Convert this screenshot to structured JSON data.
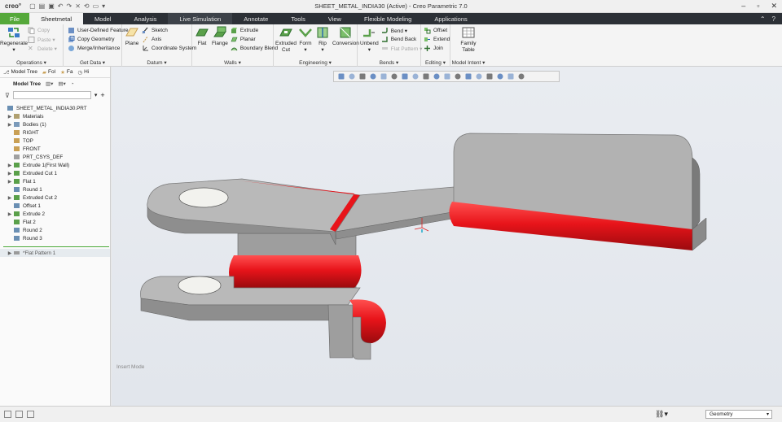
{
  "app": {
    "logo": "creo°",
    "window_title": "SHEET_METAL_INDIA30 (Active) - Creo Parametric 7.0"
  },
  "tabs": [
    {
      "label": "File"
    },
    {
      "label": "Sheetmetal"
    },
    {
      "label": "Model"
    },
    {
      "label": "Analysis"
    },
    {
      "label": "Live Simulation"
    },
    {
      "label": "Annotate"
    },
    {
      "label": "Tools"
    },
    {
      "label": "View"
    },
    {
      "label": "Flexible Modeling"
    },
    {
      "label": "Applications"
    }
  ],
  "ribbon": {
    "operations": {
      "label": "Operations ▾",
      "regenerate": "Regenerate",
      "copy": "Copy",
      "paste": "Paste ▾",
      "delete": "Delete ▾"
    },
    "getdata": {
      "label": "Get Data ▾",
      "udf": "User-Defined Feature",
      "copygeom": "Copy Geometry",
      "merge": "Merge/Inheritance"
    },
    "datum": {
      "label": "Datum ▾",
      "plane": "Plane",
      "sketch": "Sketch",
      "axis": "Axis",
      "csys": "Coordinate System"
    },
    "walls": {
      "label": "Walls ▾",
      "flat": "Flat",
      "flange": "Flange",
      "extrude": "Extrude",
      "planar": "Planar",
      "boundary": "Boundary Blend"
    },
    "engineering": {
      "label": "Engineering ▾",
      "extruded_cut_1": "Extruded",
      "extruded_cut_2": "Cut",
      "form": "Form",
      "rip": "Rip",
      "conversion": "Conversion"
    },
    "bends": {
      "label": "Bends ▾",
      "unbend": "Unbend",
      "bend": "Bend ▾",
      "bendback": "Bend Back",
      "flatpattern": "Flat Pattern ▾"
    },
    "editing": {
      "label": "Editing ▾",
      "offset": "Offset",
      "extend": "Extend",
      "join": "Join"
    },
    "modelintent": {
      "label": "Model Intent ▾",
      "family_1": "Family",
      "family_2": "Table"
    }
  },
  "panel": {
    "tabs": [
      "Model Tree",
      "Fol",
      "Fa",
      "Hi"
    ],
    "heading": "Model Tree",
    "tree": [
      {
        "label": "SHEET_METAL_INDIA30.PRT",
        "exp": "",
        "color": "#6a8fb3"
      },
      {
        "label": "Materials",
        "exp": "▶",
        "color": "#b0a070"
      },
      {
        "label": "Bodies (1)",
        "exp": "▶",
        "color": "#7a9aba"
      },
      {
        "label": "RIGHT",
        "exp": "",
        "color": "#c9a055"
      },
      {
        "label": "TOP",
        "exp": "",
        "color": "#c9a055"
      },
      {
        "label": "FRONT",
        "exp": "",
        "color": "#c9a055"
      },
      {
        "label": "PRT_CSYS_DEF",
        "exp": "",
        "color": "#a0a0a0"
      },
      {
        "label": "Extrude 1(First Wall)",
        "exp": "▶",
        "color": "#5aa04a"
      },
      {
        "label": "Extruded Cut 1",
        "exp": "▶",
        "color": "#5aa04a"
      },
      {
        "label": "Flat 1",
        "exp": "▶",
        "color": "#5aa04a"
      },
      {
        "label": "Round 1",
        "exp": "",
        "color": "#6a8fb3"
      },
      {
        "label": "Extruded Cut 2",
        "exp": "▶",
        "color": "#5aa04a"
      },
      {
        "label": "Offset 1",
        "exp": "",
        "color": "#6a8fb3"
      },
      {
        "label": "Extrude 2",
        "exp": "▶",
        "color": "#5aa04a"
      },
      {
        "label": "Flat 2",
        "exp": "",
        "color": "#5aa04a"
      },
      {
        "label": "Round 2",
        "exp": "",
        "color": "#6a8fb3"
      },
      {
        "label": "Round 3",
        "exp": "",
        "color": "#6a8fb3"
      }
    ],
    "after_insert": {
      "label": "*Flat Pattern 1",
      "exp": "▶",
      "color": "#7a7a7a"
    }
  },
  "viewport": {
    "insert_mode": "Insert Mode",
    "highlight_color": "#e8141a",
    "body_color": "#a9a9a9"
  },
  "status": {
    "selection_filter": "Geometry"
  }
}
